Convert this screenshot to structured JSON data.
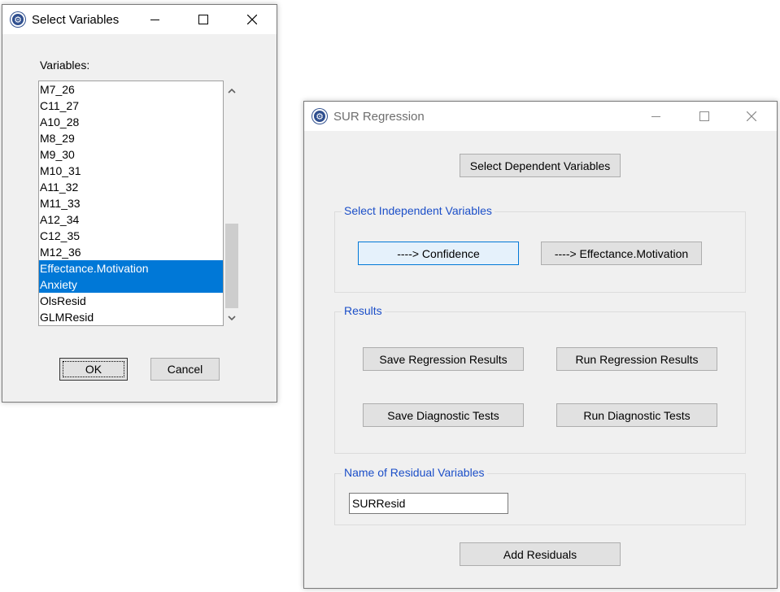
{
  "select_dialog": {
    "title": "Select Variables",
    "variables_label": "Variables:",
    "items": [
      {
        "label": "M7_26",
        "selected": false
      },
      {
        "label": "C11_27",
        "selected": false
      },
      {
        "label": "A10_28",
        "selected": false
      },
      {
        "label": "M8_29",
        "selected": false
      },
      {
        "label": "M9_30",
        "selected": false
      },
      {
        "label": "M10_31",
        "selected": false
      },
      {
        "label": "A11_32",
        "selected": false
      },
      {
        "label": "M11_33",
        "selected": false
      },
      {
        "label": "A12_34",
        "selected": false
      },
      {
        "label": "C12_35",
        "selected": false
      },
      {
        "label": "M12_36",
        "selected": false
      },
      {
        "label": "Effectance.Motivation",
        "selected": true
      },
      {
        "label": "Anxiety",
        "selected": true
      },
      {
        "label": "OlsResid",
        "selected": false
      },
      {
        "label": "GLMResid",
        "selected": false
      }
    ],
    "ok_label": "OK",
    "cancel_label": "Cancel"
  },
  "sur_dialog": {
    "title": "SUR Regression",
    "select_dependent_label": "Select Dependent Variables",
    "independent_group_label": "Select Independent Variables",
    "confidence_button": "----> Confidence",
    "effectance_button": "----> Effectance.Motivation",
    "results_group_label": "Results",
    "save_regression_label": "Save Regression Results",
    "run_regression_label": "Run Regression Results",
    "save_diagnostic_label": "Save Diagnostic Tests",
    "run_diagnostic_label": "Run Diagnostic Tests",
    "residual_group_label": "Name of Residual Variables",
    "residual_value": "SURResid",
    "add_residuals_label": "Add Residuals"
  },
  "colors": {
    "selection": "#0078d7",
    "group_label": "#1c4fc8",
    "focus_border": "#0078d7"
  }
}
